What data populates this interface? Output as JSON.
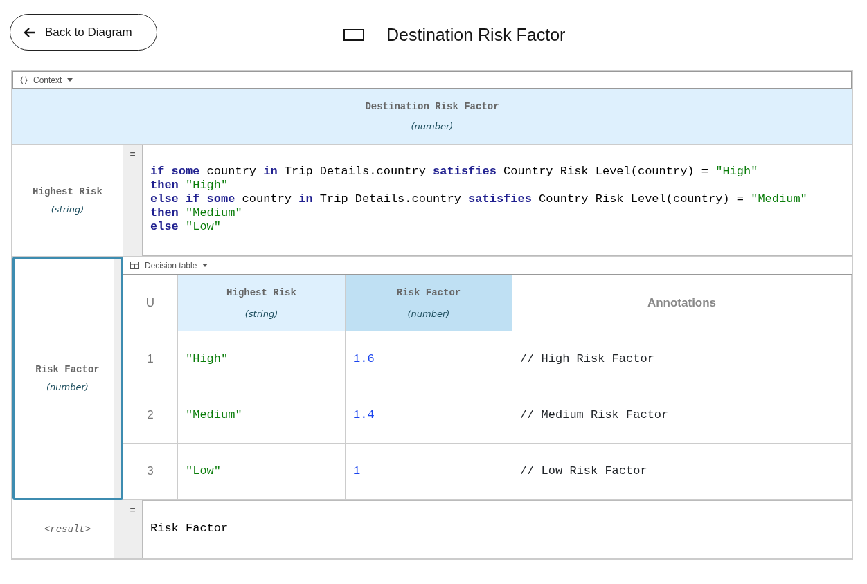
{
  "header": {
    "back_button": "Back to Diagram",
    "title": "Destination Risk Factor"
  },
  "context": {
    "label": "Context",
    "name": "Destination Risk Factor",
    "type": "(number)",
    "entries": [
      {
        "name": "Highest Risk",
        "type": "(string)",
        "selected": false,
        "kind": "literal",
        "operator": "=",
        "code": [
          [
            {
              "text": "if some",
              "kind": "keyword"
            },
            {
              "text": " country ",
              "kind": "plain"
            },
            {
              "text": "in",
              "kind": "keyword"
            },
            {
              "text": " Trip Details.country ",
              "kind": "plain"
            },
            {
              "text": "satisfies",
              "kind": "keyword"
            },
            {
              "text": " Country Risk Level(country) = ",
              "kind": "plain"
            },
            {
              "text": "\"High\"",
              "kind": "string"
            }
          ],
          [
            {
              "text": "then ",
              "kind": "keyword"
            },
            {
              "text": "\"High\"",
              "kind": "string"
            }
          ],
          [
            {
              "text": "else if some",
              "kind": "keyword"
            },
            {
              "text": " country ",
              "kind": "plain"
            },
            {
              "text": "in",
              "kind": "keyword"
            },
            {
              "text": " Trip Details.country ",
              "kind": "plain"
            },
            {
              "text": "satisfies",
              "kind": "keyword"
            },
            {
              "text": " Country Risk Level(country) = ",
              "kind": "plain"
            },
            {
              "text": "\"Medium\"",
              "kind": "string"
            }
          ],
          [
            {
              "text": "then ",
              "kind": "keyword"
            },
            {
              "text": "\"Medium\"",
              "kind": "string"
            }
          ],
          [
            {
              "text": "else ",
              "kind": "keyword"
            },
            {
              "text": "\"Low\"",
              "kind": "string"
            }
          ]
        ]
      },
      {
        "name": "Risk Factor",
        "type": "(number)",
        "selected": true,
        "kind": "decision_table",
        "table": {
          "label": "Decision table",
          "hit_policy": "U",
          "columns": [
            {
              "name": "Highest Risk",
              "type": "(string)",
              "kind": "input"
            },
            {
              "name": "Risk Factor",
              "type": "(number)",
              "kind": "output"
            },
            {
              "name": "Annotations",
              "kind": "annotation"
            }
          ],
          "rows": [
            {
              "number": "1",
              "cells": [
                {
                  "text": "\"High\"",
                  "kind": "string"
                },
                {
                  "text": "1.6",
                  "kind": "number"
                },
                {
                  "text": "// High Risk Factor",
                  "kind": "plain"
                }
              ]
            },
            {
              "number": "2",
              "cells": [
                {
                  "text": "\"Medium\"",
                  "kind": "string"
                },
                {
                  "text": "1.4",
                  "kind": "number"
                },
                {
                  "text": "// Medium Risk Factor",
                  "kind": "plain"
                }
              ]
            },
            {
              "number": "3",
              "cells": [
                {
                  "text": "\"Low\"",
                  "kind": "string"
                },
                {
                  "text": "1",
                  "kind": "number"
                },
                {
                  "text": "// Low Risk Factor",
                  "kind": "plain"
                }
              ]
            }
          ]
        }
      }
    ],
    "result": {
      "name": "<result>",
      "operator": "=",
      "code": "Risk Factor"
    }
  }
}
